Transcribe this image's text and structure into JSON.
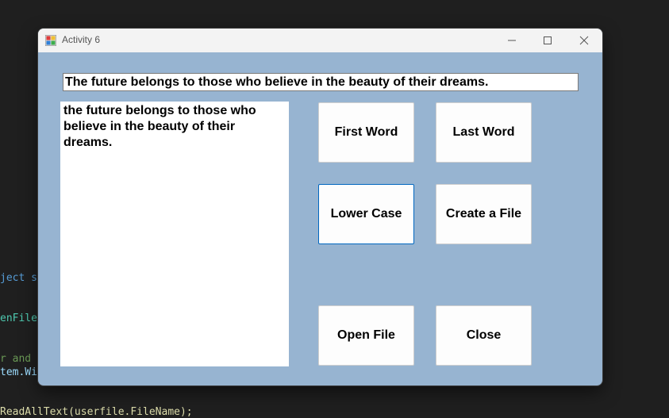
{
  "background_code": {
    "line1": "ject s",
    "line2": "enFile",
    "line3": "r and",
    "line4": "tem.Wi",
    "line5": "ReadAllText(userfile.FileName);"
  },
  "window": {
    "title": "Activity 6",
    "app_icon": "winforms-app-icon",
    "controls": {
      "minimize": "minimize-icon",
      "maximize": "maximize-icon",
      "close": "close-icon"
    }
  },
  "form": {
    "input_text": "The future belongs to those who believe in the beauty of their dreams.",
    "output_text": "the future belongs to those who believe in the beauty of their dreams.",
    "buttons": {
      "first_word": "First Word",
      "last_word": "Last Word",
      "lower_case": "Lower Case",
      "create_file": "Create a File",
      "open_file": "Open File",
      "close": "Close"
    }
  },
  "colors": {
    "form_background": "#97b4d1",
    "focus_border": "#0067c0"
  }
}
